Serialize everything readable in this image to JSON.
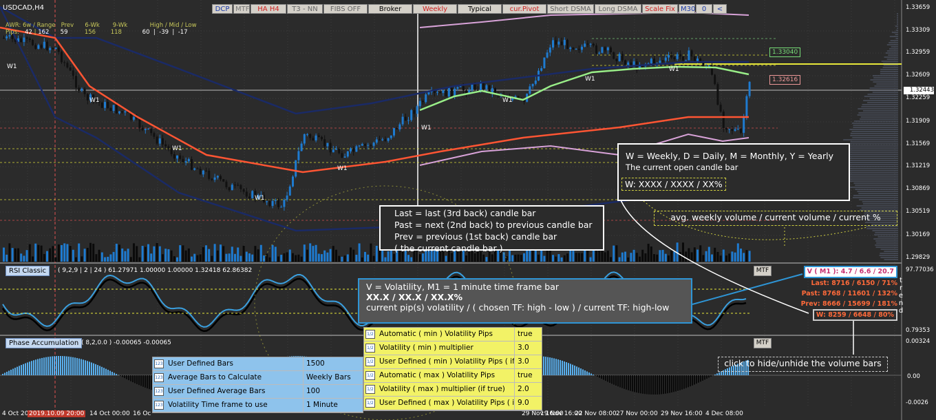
{
  "symbol": "USDCAD,H4",
  "toolbar": [
    {
      "label": "DCP",
      "color": "#1a3aa8",
      "w": 30
    },
    {
      "label": "MTF",
      "color": "#777777",
      "w": 24
    },
    {
      "label": "HA H4",
      "color": "#d02020",
      "w": 52
    },
    {
      "label": "T3 - NN",
      "color": "#666666",
      "w": 52
    },
    {
      "label": "FIBS OFF",
      "color": "#666666",
      "w": 64
    },
    {
      "label": "Broker",
      "color": "#000000",
      "w": 64
    },
    {
      "label": "Weekly",
      "color": "#d02020",
      "w": 64
    },
    {
      "label": "Typical",
      "color": "#000000",
      "w": 64
    },
    {
      "label": "cur.Pivot",
      "color": "#d02020",
      "w": 64
    },
    {
      "label": "Short DSMA",
      "color": "#666666",
      "w": 68
    },
    {
      "label": "Long DSMA",
      "color": "#666666",
      "w": 68
    },
    {
      "label": "Scale Fix",
      "color": "#d02020",
      "w": 52
    },
    {
      "label": "M30",
      "color": "#1a3aa8",
      "w": 24
    },
    {
      "label": "0",
      "color": "#1a3aa8",
      "w": 24
    },
    {
      "label": "<",
      "color": "#1a3aa8",
      "w": 20
    }
  ],
  "awr": {
    "header": "AWR: 6w / Range   Prev      6-Wk       9-Wk            High / Mid / Low",
    "values_label": "Pips:",
    "v1": "42",
    "v2": "162",
    "prev": "59",
    "wk6": "156",
    "wk9": "118",
    "hml": "60  |  -39  |  -17"
  },
  "w_labels": [
    "W1",
    "W1",
    "W1",
    "W1",
    "W1",
    "W1",
    "W1",
    "W1",
    "W1"
  ],
  "price_axis": [
    "1.33659",
    "1.33309",
    "1.32959",
    "1.32609",
    "1.32443",
    "1.32259",
    "1.31909",
    "1.31569",
    "1.31219",
    "1.30869",
    "1.30519",
    "1.30169",
    "1.29829"
  ],
  "levels": {
    "upper": "1.33040",
    "lower": "1.32616",
    "current": "1.32443"
  },
  "rsi": {
    "title": "RSI Classic",
    "values": "( 9,2,9 | 2 | 24 ) 61.27971 1.00000 1.00000 1.32418 62.86382",
    "scale_top": "97.77036",
    "scale_bottom": "0.79353",
    "mtf": "MTF"
  },
  "phase": {
    "title": "Phase Accumulation",
    "values": "( 8,2,0.0 ) -0.00065 -0.00065",
    "scale_top": "0.00324",
    "scale_mid": "0.00",
    "scale_bottom": "-0.0026",
    "mtf": "MTF"
  },
  "time_axis": [
    {
      "t": "4 Oct 20",
      "hl": false
    },
    {
      "t": "2019.10.09 20:00",
      "hl": true
    },
    {
      "t": "14 Oct 00:00",
      "hl": false
    },
    {
      "t": "16 Oc",
      "hl": false
    },
    {
      "t": "29 Nov 16:00",
      "hl": false
    },
    {
      "t": "19 Nov 16:00",
      "hl": false
    },
    {
      "t": "22 Nov 08:00",
      "hl": false
    },
    {
      "t": "27 Nov 00:00",
      "hl": false
    },
    {
      "t": "29 Nov 16:00",
      "hl": false
    },
    {
      "t": "4 Dec 08:00",
      "hl": false
    }
  ],
  "note_weekly": {
    "line1": "W = Weekly, D = Daily, M = Monthly, Y = Yearly",
    "line2": "The current open candle bar",
    "format": "W:  XXXX  /   XXXX  /   XX%"
  },
  "avg_label": "avg. weekly volume    /  current volume   /  current %",
  "note_candles": {
    "l1": "Last = last (3rd back) candle bar",
    "l2": "Past = next (2nd back) to previous candle bar",
    "l3": "Prev = previous (1st back) candle bar",
    "l4": "( the current candle bar )"
  },
  "note_volatility": {
    "l1": "V = Volatility,  M1 = 1 minute time frame bar",
    "l2": "XX.X  /  XX.X  /  XX.X%",
    "l3": "current pip(s) volatility   /  ( chosen TF: high - low )  /  current TF: high-low"
  },
  "stats": {
    "v": "V ( M1 ): 4.7 / 6.6 / 20.7",
    "last": "Last: 8716 / 6150 / 71%",
    "past": "Past: 8768 / 11601 / 132%",
    "prev": "Prev: 8666 / 15699 / 181%",
    "w": "W: 8259 / 6648 / 80%"
  },
  "trend_letters": [
    "t",
    "r",
    "e",
    "n",
    "d"
  ],
  "hide_note": "click to hide/unhide the volume bars",
  "props_left": [
    {
      "name": "User Defined Bars",
      "value": "1500"
    },
    {
      "name": "Average Bars to Calculate",
      "value": "Weekly Bars"
    },
    {
      "name": "User Defined Average Bars",
      "value": "100"
    },
    {
      "name": "Volatility Time frame to use",
      "value": "1 Minute"
    }
  ],
  "props_right": [
    {
      "name": "Automatic ( min ) Volatility Pips",
      "value": "true"
    },
    {
      "name": "Volatility ( min ) multiplier",
      "value": "3.0"
    },
    {
      "name": "User Defined ( min ) Volatility Pips ( if fa...",
      "value": "3.0"
    },
    {
      "name": "Automatic ( max ) Volatility Pips",
      "value": "true"
    },
    {
      "name": "Volatility ( max ) multiplier (if true)",
      "value": "2.0"
    },
    {
      "name": "User Defined ( max ) Volatility Pips ( if f...",
      "value": "9.0"
    }
  ],
  "colors": {
    "bull": "#1e7bd0",
    "bear": "#111111",
    "ma_red": "#ff5533",
    "ma_green": "#99ee88",
    "band_navy": "#1a2a66",
    "band_pink": "#d9a3d9",
    "highlight_blue": "#2e95d6",
    "yellow": "#e8e83a",
    "prop_left_bg": "#8ec3ec",
    "prop_right_bg": "#f2f266"
  }
}
